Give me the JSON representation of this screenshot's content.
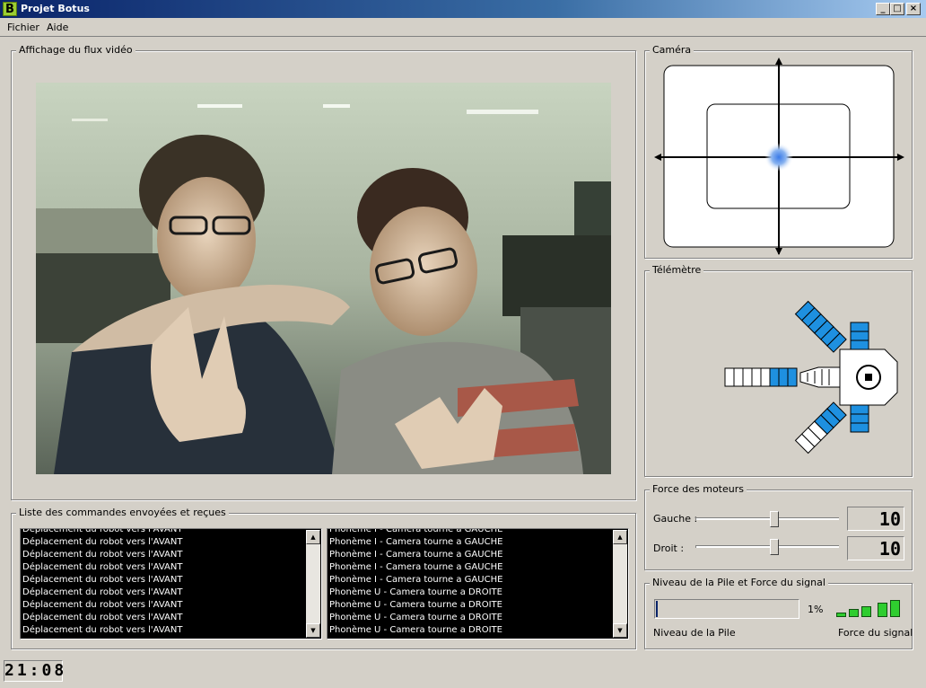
{
  "window": {
    "title": "Projet Botus",
    "icon_letter": "B"
  },
  "menu": [
    {
      "label": "Fichier"
    },
    {
      "label": "Aide"
    }
  ],
  "video": {
    "group_label": "Affichage du flux vidéo"
  },
  "camera": {
    "group_label": "Caméra"
  },
  "telemetre": {
    "group_label": "Télémètre"
  },
  "commands": {
    "group_label": "Liste des commandes envoyées et reçues",
    "sent": [
      "Déplacement du robot vers l'AVANT",
      "Déplacement du robot vers l'AVANT",
      "Déplacement du robot vers l'AVANT",
      "Déplacement du robot vers l'AVANT",
      "Déplacement du robot vers l'AVANT",
      "Déplacement du robot vers l'AVANT",
      "Déplacement du robot vers l'AVANT",
      "Déplacement du robot vers l'AVANT",
      "Déplacement du robot vers l'AVANT"
    ],
    "received": [
      "Phonème I - Camera tourne a GAUCHE",
      "Phonème I - Camera tourne a GAUCHE",
      "Phonème I - Camera tourne a GAUCHE",
      "Phonème I - Camera tourne a GAUCHE",
      "Phonème I - Camera tourne a GAUCHE",
      "Phonème U - Camera tourne a DROITE",
      "Phonème U - Camera tourne a DROITE",
      "Phonème U - Camera tourne a DROITE",
      "Phonème U - Camera tourne a DROITE"
    ]
  },
  "motors": {
    "group_label": "Force des moteurs",
    "left_label": "Gauche :",
    "right_label": "Droit :",
    "left_value": "10",
    "right_value": "10"
  },
  "battery": {
    "group_label": "Niveau de la Pile et Force du signal",
    "percent_text": "1%",
    "level_fraction": 0.01,
    "battery_caption": "Niveau de la Pile",
    "signal_caption": "Force du signal"
  },
  "clock": {
    "time": "21:08"
  },
  "colors": {
    "sensor_blue": "#1e90e0",
    "titlebar": "#0a246a",
    "signal_green": "#2fcd2f"
  }
}
